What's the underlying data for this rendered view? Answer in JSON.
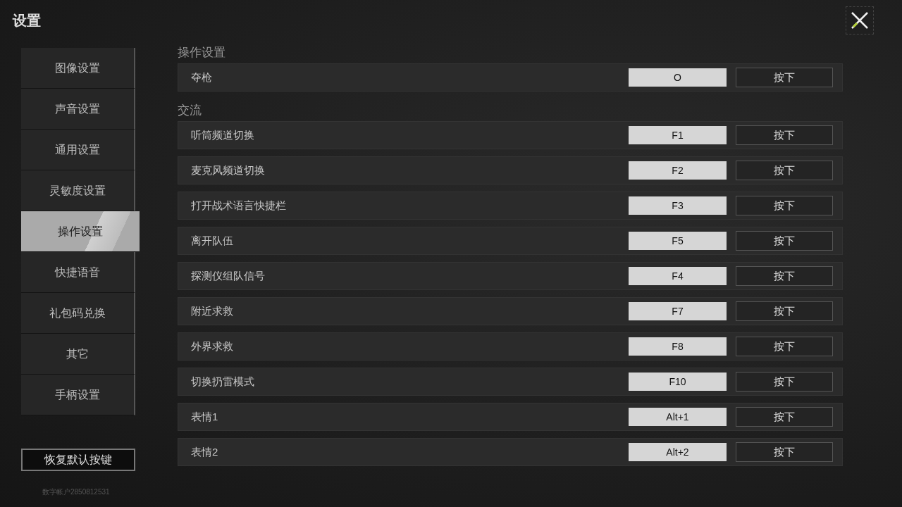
{
  "title": "设置",
  "sidebar": {
    "items": [
      {
        "label": "图像设置",
        "selected": false
      },
      {
        "label": "声音设置",
        "selected": false
      },
      {
        "label": "通用设置",
        "selected": false
      },
      {
        "label": "灵敏度设置",
        "selected": false
      },
      {
        "label": "操作设置",
        "selected": true
      },
      {
        "label": "快捷语音",
        "selected": false
      },
      {
        "label": "礼包码兑换",
        "selected": false
      },
      {
        "label": "其它",
        "selected": false
      },
      {
        "label": "手柄设置",
        "selected": false
      }
    ],
    "restore_button": "恢复默认按键",
    "account_id": "数字帐户2850812531"
  },
  "sections": [
    {
      "title": "操作设置",
      "rows": [
        {
          "action": "夺枪",
          "key": "O",
          "button": "按下"
        }
      ]
    },
    {
      "title": "交流",
      "rows": [
        {
          "action": "听筒频道切换",
          "key": "F1",
          "button": "按下"
        },
        {
          "action": "麦克风频道切换",
          "key": "F2",
          "button": "按下"
        },
        {
          "action": "打开战术语言快捷栏",
          "key": "F3",
          "button": "按下"
        },
        {
          "action": "离开队伍",
          "key": "F5",
          "button": "按下"
        },
        {
          "action": "探测仪组队信号",
          "key": "F4",
          "button": "按下"
        },
        {
          "action": "附近求救",
          "key": "F7",
          "button": "按下"
        },
        {
          "action": "外界求救",
          "key": "F8",
          "button": "按下"
        },
        {
          "action": "切换扔雷模式",
          "key": "F10",
          "button": "按下"
        },
        {
          "action": "表情1",
          "key": "Alt+1",
          "button": "按下"
        },
        {
          "action": "表情2",
          "key": "Alt+2",
          "button": "按下"
        }
      ]
    }
  ]
}
